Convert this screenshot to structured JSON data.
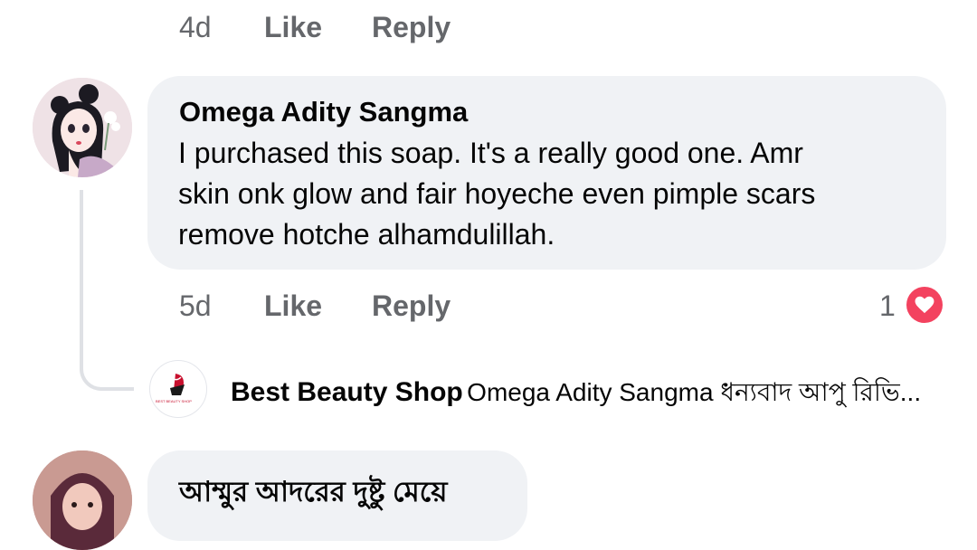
{
  "top_actions": {
    "time": "4d",
    "like": "Like",
    "reply": "Reply"
  },
  "comment": {
    "author": "Omega Adity Sangma",
    "lines": [
      "I purchased this soap. It's a really good one. Amr",
      "skin onk glow and fair hoyeche even pimple scars",
      "remove hotche alhamdulillah."
    ],
    "time": "5d",
    "like": "Like",
    "reply": "Reply",
    "reaction_count": "1",
    "reaction_icon": "heart-icon"
  },
  "reply_preview": {
    "author": "Best Beauty Shop",
    "snippet": "Omega Adity Sangma ধন্যবাদ আপু রিভি...",
    "logo_text": "BEST BEAUTY SHOP"
  },
  "next_comment": {
    "author": "আম্মুর আদরের দুষ্টু মেয়ে"
  },
  "colors": {
    "bubble_bg": "#f0f2f5",
    "meta_text": "#65676b",
    "heart": "#f3425f",
    "thread_line": "#dfe1e5"
  }
}
